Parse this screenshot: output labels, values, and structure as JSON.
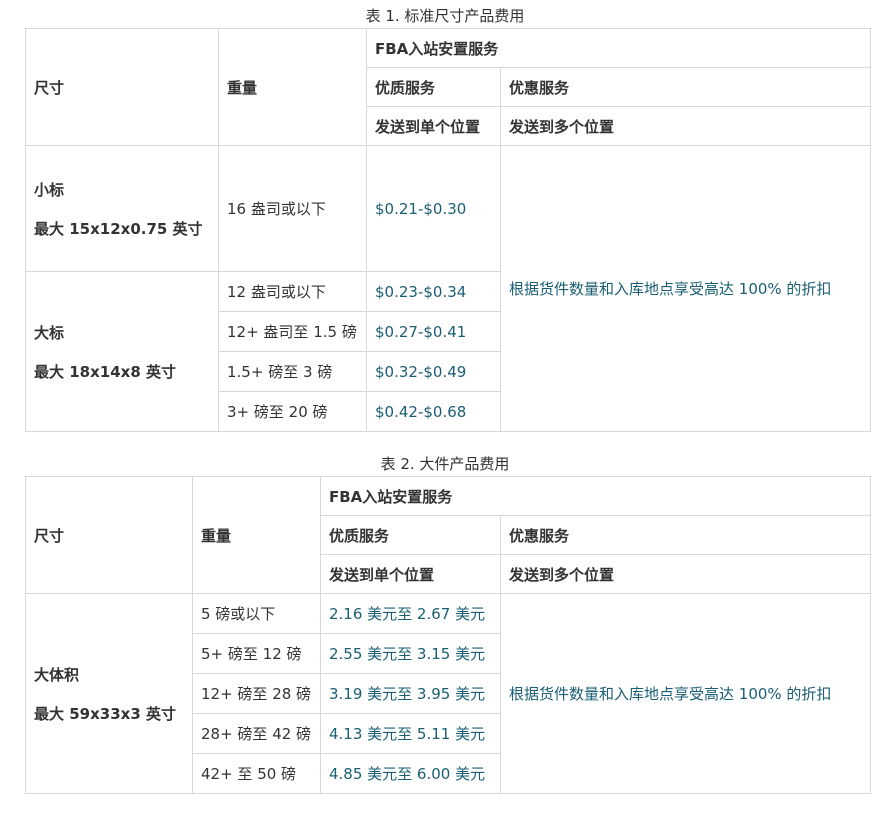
{
  "table1": {
    "caption": "表 1. 标准尺寸产品费用",
    "header": {
      "size": "尺寸",
      "weight": "重量",
      "service_group": "FBA入站安置服务",
      "premium": "优质服务",
      "discount": "优惠服务",
      "premium_sub": "发送到单个位置",
      "discount_sub": "发送到多个位置"
    },
    "small": {
      "name": "小标",
      "dims": "最大 15x12x0.75 英寸",
      "rows": [
        {
          "weight": "16 盎司或以下",
          "price": "$0.21-$0.30"
        }
      ]
    },
    "large": {
      "name": "大标",
      "dims": "最大 18x14x8 英寸",
      "rows": [
        {
          "weight": "12 盎司或以下",
          "price": "$0.23-$0.34"
        },
        {
          "weight": "12+ 盎司至 1.5 磅",
          "price": "$0.27-$0.41"
        },
        {
          "weight": "1.5+ 磅至 3 磅",
          "price": "$0.32-$0.49"
        },
        {
          "weight": "3+ 磅至 20 磅",
          "price": "$0.42-$0.68"
        }
      ]
    },
    "discount_note": "根据货件数量和入库地点享受高达 100% 的折扣"
  },
  "table2": {
    "caption": "表 2. 大件产品费用",
    "header": {
      "size": "尺寸",
      "weight": "重量",
      "service_group": "FBA入站安置服务",
      "premium": "优质服务",
      "discount": "优惠服务",
      "premium_sub": "发送到单个位置",
      "discount_sub": "发送到多个位置"
    },
    "bulky": {
      "name": "大体积",
      "dims": "最大 59x33x3 英寸",
      "rows": [
        {
          "weight": "5 磅或以下",
          "price": "2.16 美元至 2.67 美元"
        },
        {
          "weight": "5+ 磅至 12 磅",
          "price": "2.55 美元至 3.15 美元"
        },
        {
          "weight": "12+ 磅至 28 磅",
          "price": "3.19 美元至 3.95 美元"
        },
        {
          "weight": "28+ 磅至 42 磅",
          "price": "4.13 美元至 5.11 美元"
        },
        {
          "weight": "42+ 至 50 磅",
          "price": "4.85 美元至 6.00 美元"
        }
      ]
    },
    "discount_note": "根据货件数量和入库地点享受高达 100% 的折扣"
  }
}
